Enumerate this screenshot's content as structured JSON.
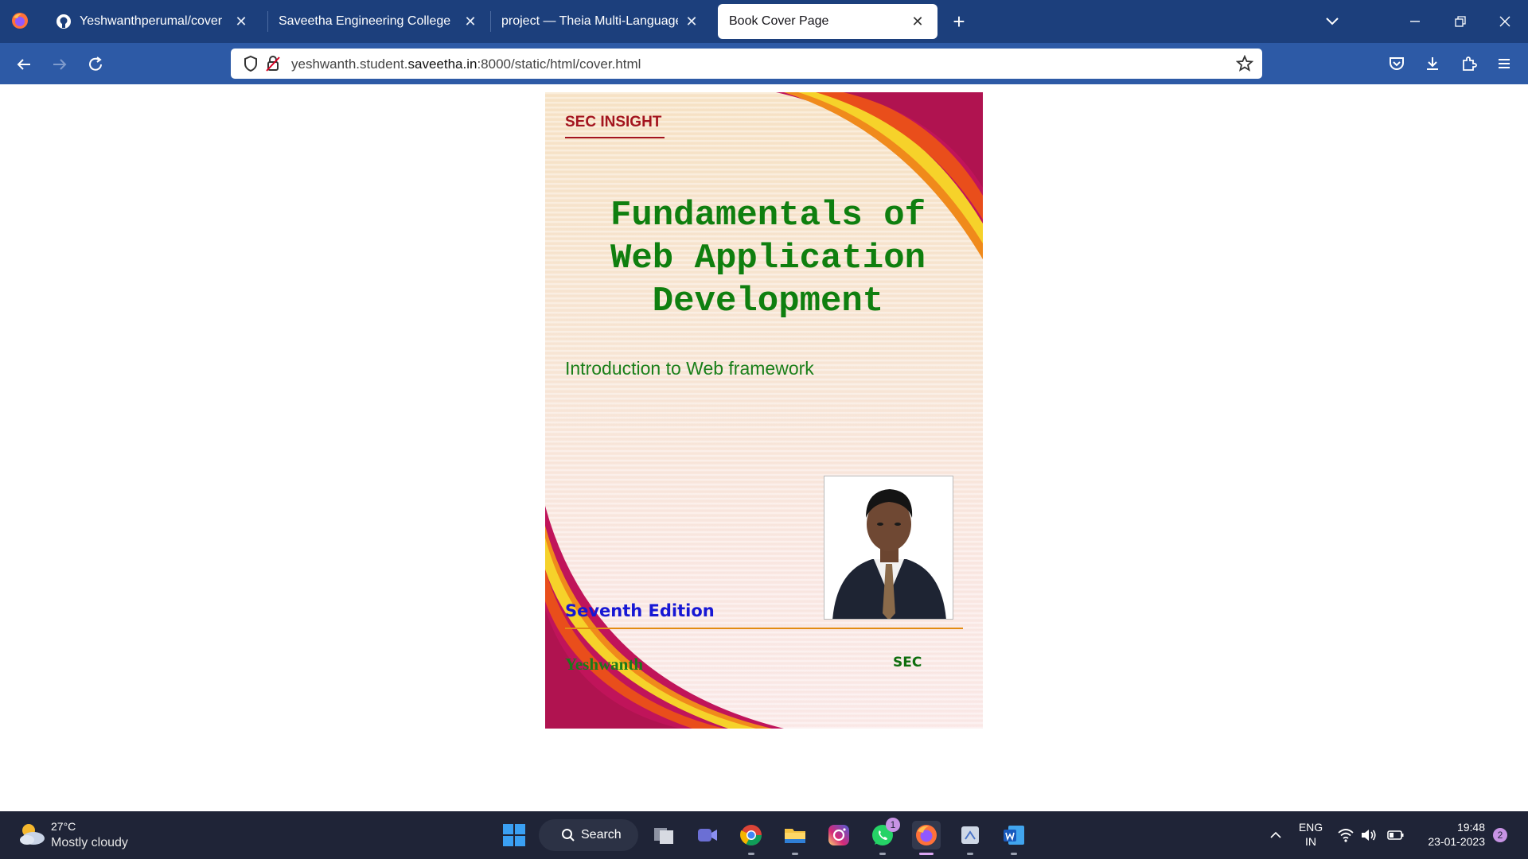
{
  "browser": {
    "tabs": [
      {
        "title": "Yeshwanthperumal/cover",
        "icon": "github-icon",
        "active": false
      },
      {
        "title": "Saveetha Engineering College",
        "icon": "none",
        "active": false
      },
      {
        "title": "project — Theia Multi-Language Ex",
        "icon": "none",
        "active": false
      },
      {
        "title": "Book Cover Page",
        "icon": "none",
        "active": true
      }
    ],
    "url_prefix": "yeshwanth.student.",
    "url_host": "saveetha.in",
    "url_suffix": ":8000/static/html/cover.html"
  },
  "cover": {
    "series": "SEC INSIGHT",
    "title_lines": [
      "Fundamentals of",
      "Web Application",
      "Development"
    ],
    "subtitle": "Introduction to Web framework",
    "edition": "Seventh Edition",
    "author": "Yeshwanth",
    "publisher": "SEC"
  },
  "taskbar": {
    "weather_temp": "27°C",
    "weather_desc": "Mostly cloudy",
    "search_label": "Search",
    "whatsapp_badge": "1",
    "lang_top": "ENG",
    "lang_bottom": "IN",
    "time": "19:48",
    "date": "23-01-2023",
    "notification_count": "2"
  },
  "colors": {
    "tabbar": "#1c3f7c",
    "navbar": "#2d5aa6",
    "title_green": "#0f7f0f",
    "series_red": "#a3141e",
    "edition_blue": "#1717d4",
    "edition_line": "#e38b13"
  }
}
